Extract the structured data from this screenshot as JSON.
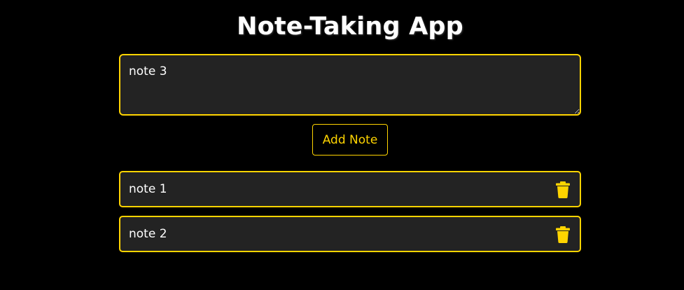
{
  "app": {
    "title": "Note-Taking App",
    "accent_color": "#ffd400",
    "background_color": "#000000",
    "panel_color": "#232323"
  },
  "input": {
    "value": "note 3"
  },
  "add_button": {
    "label": "Add Note"
  },
  "notes": [
    {
      "text": "note 1",
      "delete_icon": "trash-icon"
    },
    {
      "text": "note 2",
      "delete_icon": "trash-icon"
    }
  ]
}
